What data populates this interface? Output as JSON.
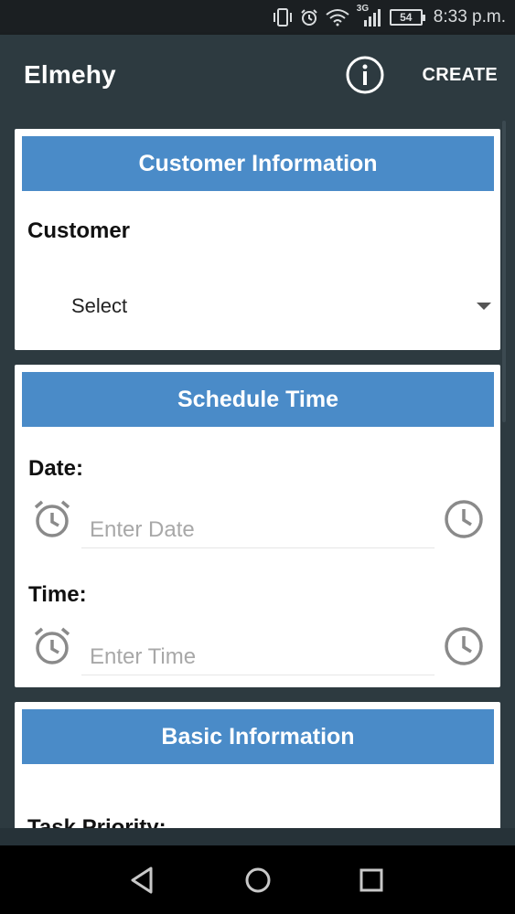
{
  "status_bar": {
    "network_label": "3G",
    "battery_level": "54",
    "time": "8:33 p.m.",
    "icons": [
      "vibrate-icon",
      "alarm-icon",
      "wifi-icon",
      "signal-icon",
      "battery-icon"
    ]
  },
  "app_bar": {
    "title": "Elmehy",
    "info_icon": "info-icon",
    "create_label": "CREATE"
  },
  "customer_card": {
    "header": "Customer Information",
    "customer_label": "Customer",
    "customer_value": "Select"
  },
  "schedule_card": {
    "header": "Schedule Time",
    "date_label": "Date:",
    "date_placeholder": "Enter Date",
    "time_label": "Time:",
    "time_placeholder": "Enter Time"
  },
  "basic_card": {
    "header": "Basic Information",
    "priority_label": "Task Priority:"
  },
  "colors": {
    "app_bar": "#2d3a40",
    "card_header": "#4a8bc8",
    "icon_gray": "#8a8a8a"
  }
}
